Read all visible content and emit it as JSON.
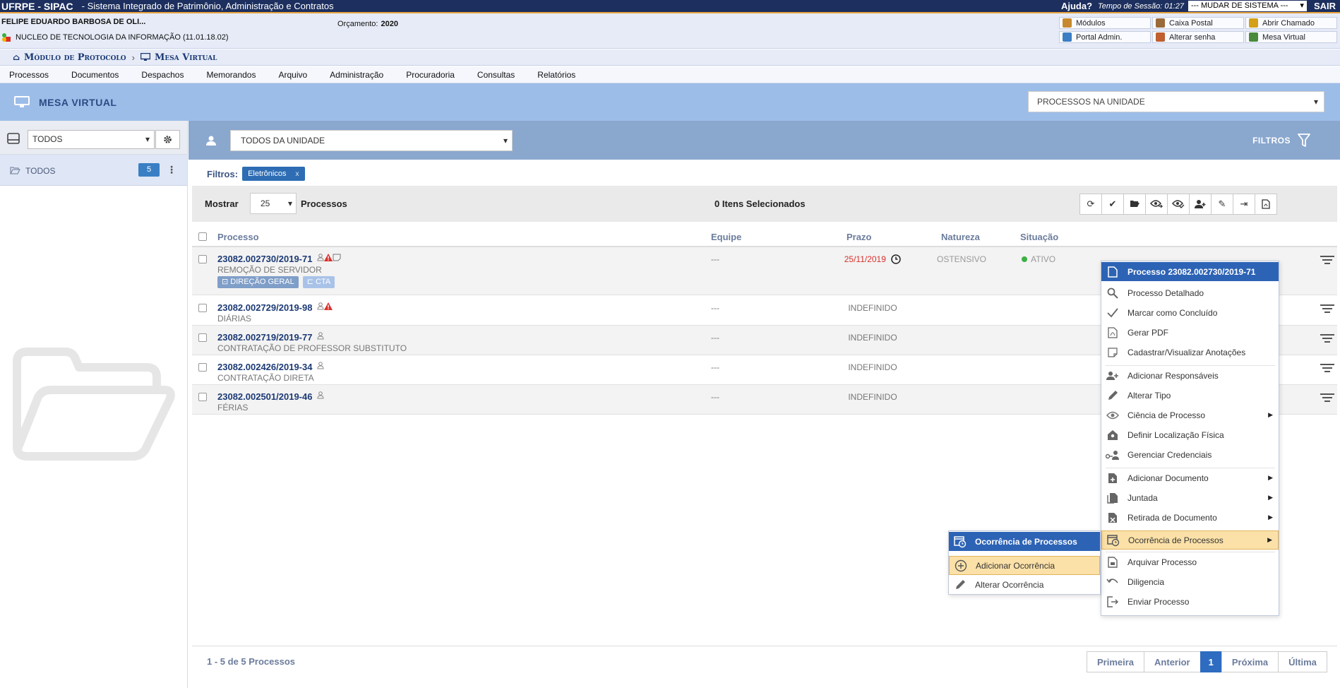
{
  "topbar": {
    "system": "UFRPE - SIPAC",
    "system_name": "- Sistema Integrado de Patrimônio, Administração e Contratos",
    "help": "Ajuda?",
    "session": "Tempo de Sessão: 01:27",
    "change_system": "--- MUDAR DE SISTEMA ---",
    "logout": "SAIR"
  },
  "user": {
    "name": "FELIPE EDUARDO BARBOSA DE OLI...",
    "unit": "NUCLEO DE TECNOLOGIA DA INFORMAÇÃO (11.01.18.02)",
    "budget_label": "Orçamento:",
    "budget_year": "2020"
  },
  "shortcuts": [
    {
      "label": "Módulos",
      "icon": "modules-icon",
      "color": "#c8892e"
    },
    {
      "label": "Caixa Postal",
      "icon": "mailbox-icon",
      "color": "#9a6a3a"
    },
    {
      "label": "Abrir Chamado",
      "icon": "ticket-icon",
      "color": "#d4a018"
    },
    {
      "label": "Portal Admin.",
      "icon": "portal-icon",
      "color": "#3b7ec4"
    },
    {
      "label": "Alterar senha",
      "icon": "password-icon",
      "color": "#c06030"
    },
    {
      "label": "Mesa Virtual",
      "icon": "virtual-desk-icon",
      "color": "#4a8a3a"
    }
  ],
  "breadcrumb": {
    "module": "Módulo de Protocolo",
    "current": "Mesa Virtual"
  },
  "menu": [
    "Processos",
    "Documentos",
    "Despachos",
    "Memorandos",
    "Arquivo",
    "Administração",
    "Procuradoria",
    "Consultas",
    "Relatórios"
  ],
  "header": {
    "title": "MESA VIRTUAL",
    "view_select": "PROCESSOS NA UNIDADE"
  },
  "left": {
    "folder_select": "TODOS",
    "item_label": "TODOS",
    "item_count": "5"
  },
  "filterbar": {
    "owner_select": "TODOS DA UNIDADE",
    "filters_label": "FILTROS"
  },
  "active_filters": {
    "label": "Filtros:",
    "chip": "Eletrônicos",
    "chip_close": "x"
  },
  "toolbar": {
    "show_label": "Mostrar",
    "page_size": "25",
    "items_label": "Processos",
    "selected": "0 Itens Selecionados"
  },
  "columns": {
    "processo": "Processo",
    "equipe": "Equipe",
    "prazo": "Prazo",
    "natureza": "Natureza",
    "situacao": "Situação"
  },
  "rows": [
    {
      "number": "23082.002730/2019-71",
      "desc": "REMOÇÃO DE SERVIDOR",
      "equipe": "---",
      "prazo": "25/11/2019",
      "natureza": "OSTENSIVO",
      "situacao": "ATIVO",
      "tag1": "DIREÇÃO GERAL",
      "tag2": "CTA"
    },
    {
      "number": "23082.002729/2019-98",
      "desc": "DIÁRIAS",
      "equipe": "---",
      "prazo": "INDEFINIDO"
    },
    {
      "number": "23082.002719/2019-77",
      "desc": "CONTRATAÇÃO DE PROFESSOR SUBSTITUTO",
      "equipe": "---",
      "prazo": "INDEFINIDO"
    },
    {
      "number": "23082.002426/2019-34",
      "desc": "CONTRATAÇÃO DIRETA",
      "equipe": "---",
      "prazo": "INDEFINIDO"
    },
    {
      "number": "23082.002501/2019-46",
      "desc": "FÉRIAS",
      "equipe": "---",
      "prazo": "INDEFINIDO"
    }
  ],
  "context_menu": {
    "header": "Processo 23082.002730/2019-71",
    "items": [
      "Processo Detalhado",
      "Marcar como Concluído",
      "Gerar PDF",
      "Cadastrar/Visualizar Anotações",
      "Adicionar Responsáveis",
      "Alterar Tipo",
      "Ciência de Processo",
      "Definir Localização Física",
      "Gerenciar Credenciais",
      "Adicionar Documento",
      "Juntada",
      "Retirada de Documento",
      "Ocorrência de Processos",
      "Arquivar Processo",
      "Diligencia",
      "Enviar Processo"
    ]
  },
  "submenu": {
    "header": "Ocorrência de Processos",
    "items": [
      "Adicionar Ocorrência",
      "Alterar Ocorrência"
    ]
  },
  "footer": {
    "count": "1 - 5 de 5 Processos",
    "pager": [
      "Primeira",
      "Anterior",
      "1",
      "Próxima",
      "Última"
    ]
  },
  "colors": {
    "navy": "#1c2f5e",
    "accent_blue": "#2d63b5",
    "header_blue": "#9dbde9",
    "filter_blue": "#8aa7ce",
    "alert_red": "#d9302a",
    "active_green": "#3cb043",
    "hover_yellow": "#fbe1a8"
  }
}
